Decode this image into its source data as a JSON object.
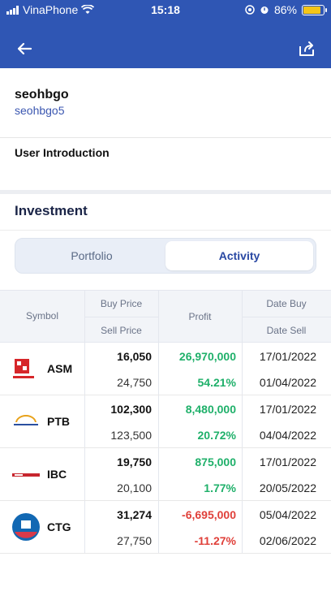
{
  "status_bar": {
    "carrier": "VinaPhone",
    "time": "15:18",
    "battery": "86%"
  },
  "profile": {
    "display_name": "seohbgo",
    "username": "seohbgo5"
  },
  "intro": {
    "title": "User Introduction"
  },
  "investment": {
    "title": "Investment",
    "tabs": [
      {
        "label": "Portfolio",
        "active": false
      },
      {
        "label": "Activity",
        "active": true
      }
    ],
    "headers": {
      "symbol": "Symbol",
      "buy_price": "Buy Price",
      "sell_price": "Sell Price",
      "profit": "Profit",
      "date_buy": "Date Buy",
      "date_sell": "Date Sell"
    },
    "rows": [
      {
        "symbol": "ASM",
        "buy_price": "16,050",
        "sell_price": "24,750",
        "profit": "26,970,000",
        "profit_pct": "54.21%",
        "date_buy": "17/01/2022",
        "date_sell": "01/04/2022",
        "sign": "pos"
      },
      {
        "symbol": "PTB",
        "buy_price": "102,300",
        "sell_price": "123,500",
        "profit": "8,480,000",
        "profit_pct": "20.72%",
        "date_buy": "17/01/2022",
        "date_sell": "04/04/2022",
        "sign": "pos"
      },
      {
        "symbol": "IBC",
        "buy_price": "19,750",
        "sell_price": "20,100",
        "profit": "875,000",
        "profit_pct": "1.77%",
        "date_buy": "17/01/2022",
        "date_sell": "20/05/2022",
        "sign": "pos"
      },
      {
        "symbol": "CTG",
        "buy_price": "31,274",
        "sell_price": "27,750",
        "profit": "-6,695,000",
        "profit_pct": "-11.27%",
        "date_buy": "05/04/2022",
        "date_sell": "02/06/2022",
        "sign": "neg"
      }
    ]
  },
  "colors": {
    "header_bg": "#2f56b4",
    "positive": "#1fb06a",
    "negative": "#e0403a",
    "link": "#3a56b0"
  },
  "icons": {
    "back": "arrow-left-icon",
    "share": "share-icon",
    "wifi": "wifi-icon",
    "alarm": "alarm-icon"
  }
}
